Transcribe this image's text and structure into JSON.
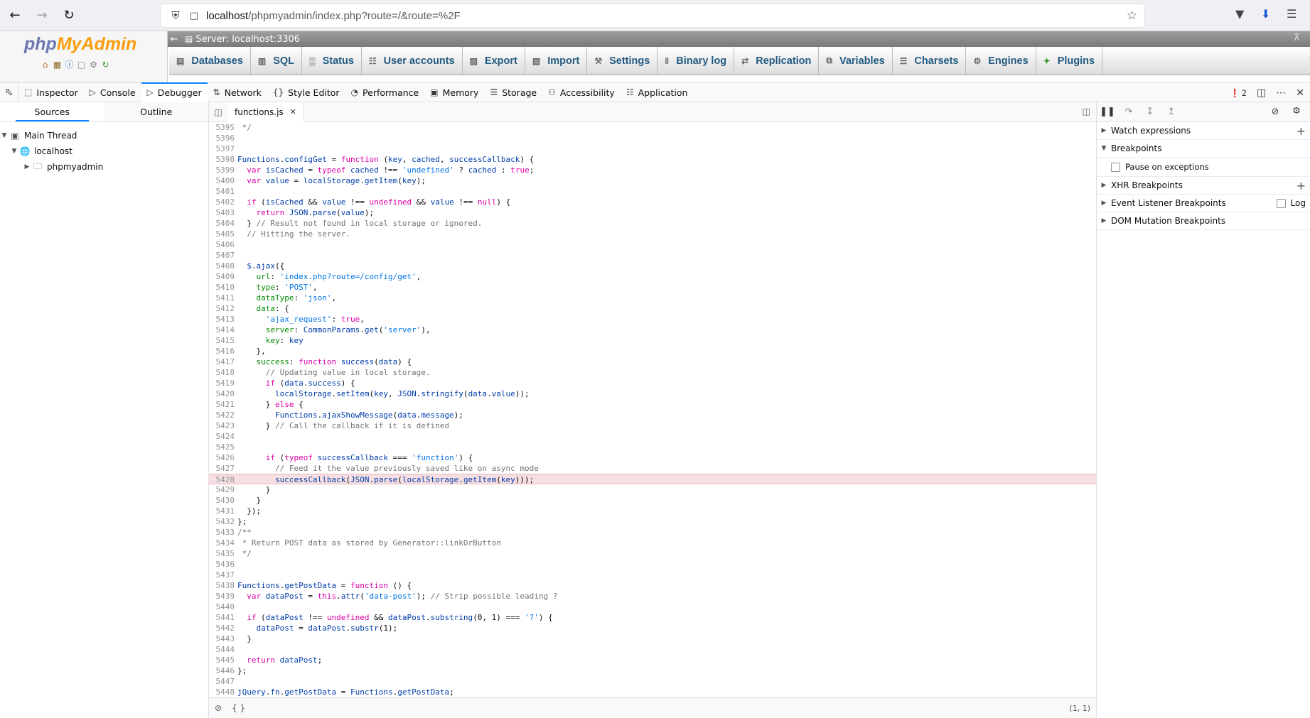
{
  "browser": {
    "url_host": "localhost",
    "url_path": "/phpmyadmin/index.php?route=/&route=%2F"
  },
  "pma": {
    "logo_php": "php",
    "logo_rest": "MyAdmin",
    "server_label": "Server: localhost:3306",
    "tabs": [
      {
        "label": "Databases",
        "icon": "database-icon"
      },
      {
        "label": "SQL",
        "icon": "sql-icon"
      },
      {
        "label": "Status",
        "icon": "status-icon"
      },
      {
        "label": "User accounts",
        "icon": "user-accounts-icon"
      },
      {
        "label": "Export",
        "icon": "export-icon"
      },
      {
        "label": "Import",
        "icon": "import-icon"
      },
      {
        "label": "Settings",
        "icon": "settings-icon"
      },
      {
        "label": "Binary log",
        "icon": "binary-log-icon"
      },
      {
        "label": "Replication",
        "icon": "replication-icon"
      },
      {
        "label": "Variables",
        "icon": "variables-icon"
      },
      {
        "label": "Charsets",
        "icon": "charsets-icon"
      },
      {
        "label": "Engines",
        "icon": "engines-icon"
      },
      {
        "label": "Plugins",
        "icon": "plugins-icon"
      }
    ]
  },
  "devtools": {
    "tabs": [
      {
        "label": "Inspector",
        "icon": "inspector-icon",
        "active": false
      },
      {
        "label": "Console",
        "icon": "console-icon",
        "active": false
      },
      {
        "label": "Debugger",
        "icon": "debugger-icon",
        "active": true
      },
      {
        "label": "Network",
        "icon": "network-icon",
        "active": false
      },
      {
        "label": "Style Editor",
        "icon": "style-editor-icon",
        "active": false
      },
      {
        "label": "Performance",
        "icon": "performance-icon",
        "active": false
      },
      {
        "label": "Memory",
        "icon": "memory-icon",
        "active": false
      },
      {
        "label": "Storage",
        "icon": "storage-icon",
        "active": false
      },
      {
        "label": "Accessibility",
        "icon": "accessibility-icon",
        "active": false
      },
      {
        "label": "Application",
        "icon": "application-icon",
        "active": false
      }
    ],
    "error_count": "2"
  },
  "sources": {
    "tab_sources": "Sources",
    "tab_outline": "Outline",
    "tree": {
      "main_thread": "Main Thread",
      "host": "localhost",
      "folder": "phpmyadmin"
    }
  },
  "editor": {
    "file_tab": "functions.js",
    "cursor_position": "(1, 1)",
    "paused_line": 5428,
    "lines": [
      {
        "n": 5395,
        "t": " */"
      },
      {
        "n": 5396,
        "t": ""
      },
      {
        "n": 5397,
        "t": ""
      },
      {
        "n": 5398,
        "t": "Functions.configGet = function (key, cached, successCallback) {"
      },
      {
        "n": 5399,
        "t": "  var isCached = typeof cached !== 'undefined' ? cached : true;"
      },
      {
        "n": 5400,
        "t": "  var value = localStorage.getItem(key);"
      },
      {
        "n": 5401,
        "t": ""
      },
      {
        "n": 5402,
        "t": "  if (isCached && value !== undefined && value !== null) {"
      },
      {
        "n": 5403,
        "t": "    return JSON.parse(value);"
      },
      {
        "n": 5404,
        "t": "  } // Result not found in local storage or ignored."
      },
      {
        "n": 5405,
        "t": "  // Hitting the server."
      },
      {
        "n": 5406,
        "t": ""
      },
      {
        "n": 5407,
        "t": ""
      },
      {
        "n": 5408,
        "t": "  $.ajax({"
      },
      {
        "n": 5409,
        "t": "    url: 'index.php?route=/config/get',"
      },
      {
        "n": 5410,
        "t": "    type: 'POST',"
      },
      {
        "n": 5411,
        "t": "    dataType: 'json',"
      },
      {
        "n": 5412,
        "t": "    data: {"
      },
      {
        "n": 5413,
        "t": "      'ajax_request': true,"
      },
      {
        "n": 5414,
        "t": "      server: CommonParams.get('server'),"
      },
      {
        "n": 5415,
        "t": "      key: key"
      },
      {
        "n": 5416,
        "t": "    },"
      },
      {
        "n": 5417,
        "t": "    success: function success(data) {"
      },
      {
        "n": 5418,
        "t": "      // Updating value in local storage."
      },
      {
        "n": 5419,
        "t": "      if (data.success) {"
      },
      {
        "n": 5420,
        "t": "        localStorage.setItem(key, JSON.stringify(data.value));"
      },
      {
        "n": 5421,
        "t": "      } else {"
      },
      {
        "n": 5422,
        "t": "        Functions.ajaxShowMessage(data.message);"
      },
      {
        "n": 5423,
        "t": "      } // Call the callback if it is defined"
      },
      {
        "n": 5424,
        "t": ""
      },
      {
        "n": 5425,
        "t": ""
      },
      {
        "n": 5426,
        "t": "      if (typeof successCallback === 'function') {"
      },
      {
        "n": 5427,
        "t": "        // Feed it the value previously saved like on async mode"
      },
      {
        "n": 5428,
        "t": "        successCallback(JSON.parse(localStorage.getItem(key)));"
      },
      {
        "n": 5429,
        "t": "      }"
      },
      {
        "n": 5430,
        "t": "    }"
      },
      {
        "n": 5431,
        "t": "  });"
      },
      {
        "n": 5432,
        "t": "};"
      },
      {
        "n": 5433,
        "t": "/**"
      },
      {
        "n": 5434,
        "t": " * Return POST data as stored by Generator::linkOrButton"
      },
      {
        "n": 5435,
        "t": " */"
      },
      {
        "n": 5436,
        "t": ""
      },
      {
        "n": 5437,
        "t": ""
      },
      {
        "n": 5438,
        "t": "Functions.getPostData = function () {"
      },
      {
        "n": 5439,
        "t": "  var dataPost = this.attr('data-post'); // Strip possible leading ?"
      },
      {
        "n": 5440,
        "t": ""
      },
      {
        "n": 5441,
        "t": "  if (dataPost !== undefined && dataPost.substring(0, 1) === '?') {"
      },
      {
        "n": 5442,
        "t": "    dataPost = dataPost.substr(1);"
      },
      {
        "n": 5443,
        "t": "  }"
      },
      {
        "n": 5444,
        "t": ""
      },
      {
        "n": 5445,
        "t": "  return dataPost;"
      },
      {
        "n": 5446,
        "t": "};"
      },
      {
        "n": 5447,
        "t": ""
      },
      {
        "n": 5448,
        "t": "jQuery.fn.getPostData = Functions.getPostData;"
      }
    ]
  },
  "breakpoints_pane": {
    "watch_expressions": "Watch expressions",
    "breakpoints": "Breakpoints",
    "pause_on_exceptions": "Pause on exceptions",
    "xhr_breakpoints": "XHR Breakpoints",
    "event_listener_breakpoints": "Event Listener Breakpoints",
    "log_label": "Log",
    "dom_mutation_breakpoints": "DOM Mutation Breakpoints"
  }
}
